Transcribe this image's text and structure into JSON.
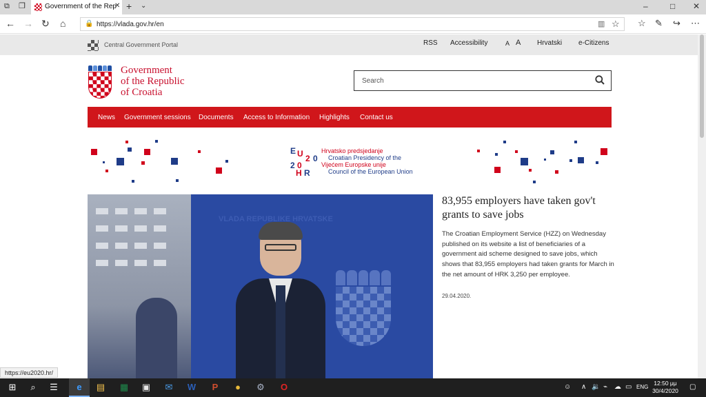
{
  "browser": {
    "tab_title": "Government of the Rep",
    "url": "https://vlada.gov.hr/en"
  },
  "site": {
    "portal_label": "Central Government Portal",
    "top_links": [
      "RSS",
      "Accessibility",
      "A",
      "A",
      "Hrvatski",
      "e-Citizens"
    ],
    "logo_lines": [
      "Government",
      "of the Republic",
      "of Croatia"
    ],
    "search_placeholder": "Search",
    "nav": [
      "News",
      "Government sessions",
      "Documents",
      "Access to Information",
      "Highlights",
      "Contact us"
    ],
    "eu_banner": {
      "logo_letters": [
        "E",
        "U",
        "2",
        "0",
        "2",
        "0",
        "H",
        "R"
      ],
      "lines": [
        "Hrvatsko predsjedanje",
        "Croatian Presidency of the",
        "Vijećem Europske unije",
        "Council of the European Union"
      ]
    }
  },
  "hero": {
    "image_text": "VLADA REPUBLIKE HRVATSKE",
    "title": "83,955 employers have taken gov't grants to save jobs",
    "body": "The Croatian Employment Service (HZZ) on Wednesday published on its website a list of beneficiaries of a government aid scheme designed to save jobs, which shows that 83,955 employers had taken grants for March in the net amount of HRK 3,250 per employee.",
    "date": "29.04.2020."
  },
  "status_bar_url": "https://eu2020.hr/",
  "taskbar": {
    "time": "12:50 μμ",
    "date": "30/4/2020",
    "lang": "ENG"
  },
  "colors": {
    "brand_red": "#d0161b",
    "brand_blue": "#1f3c88"
  }
}
